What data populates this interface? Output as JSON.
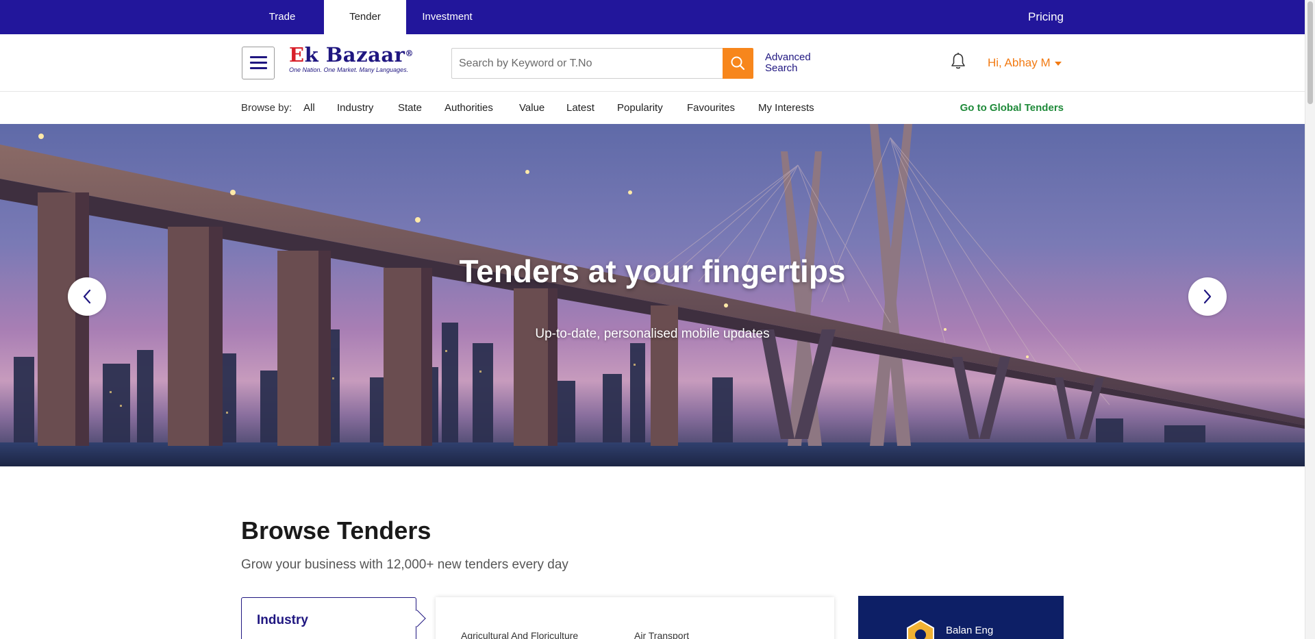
{
  "topbar": {
    "tabs": [
      {
        "label": "Trade",
        "active": false
      },
      {
        "label": "Tender",
        "active": true
      },
      {
        "label": "Investment",
        "active": false
      }
    ],
    "pricing": "Pricing",
    "bg_color": "#22169b"
  },
  "header": {
    "logo": {
      "name_prefix": "E",
      "name_rest": "k Bazaar",
      "trademark": "®",
      "tagline": "One Nation. One Market. Many Languages."
    },
    "search": {
      "placeholder": "Search by Keyword or T.No",
      "value": ""
    },
    "advanced_search": "Advanced Search",
    "user_greeting": "Hi, Abhay M",
    "accent_color": "#f7861c"
  },
  "browse_bar": {
    "label": "Browse by:",
    "items": [
      "All",
      "Industry",
      "State",
      "Authorities",
      "Value",
      "Latest",
      "Popularity",
      "Favourites",
      "My Interests"
    ],
    "global_link": "Go to Global Tenders"
  },
  "hero": {
    "title": "Tenders at your fingertips",
    "subtitle": "Up-to-date, personalised mobile updates"
  },
  "browse_tenders": {
    "title": "Browse Tenders",
    "subtitle": "Grow your business with 12,000+ new tenders every day",
    "active_filter": "Industry",
    "categories": [
      "Agricultural And Floriculture",
      "Air Transport"
    ],
    "promo_name": "Balan Eng"
  }
}
